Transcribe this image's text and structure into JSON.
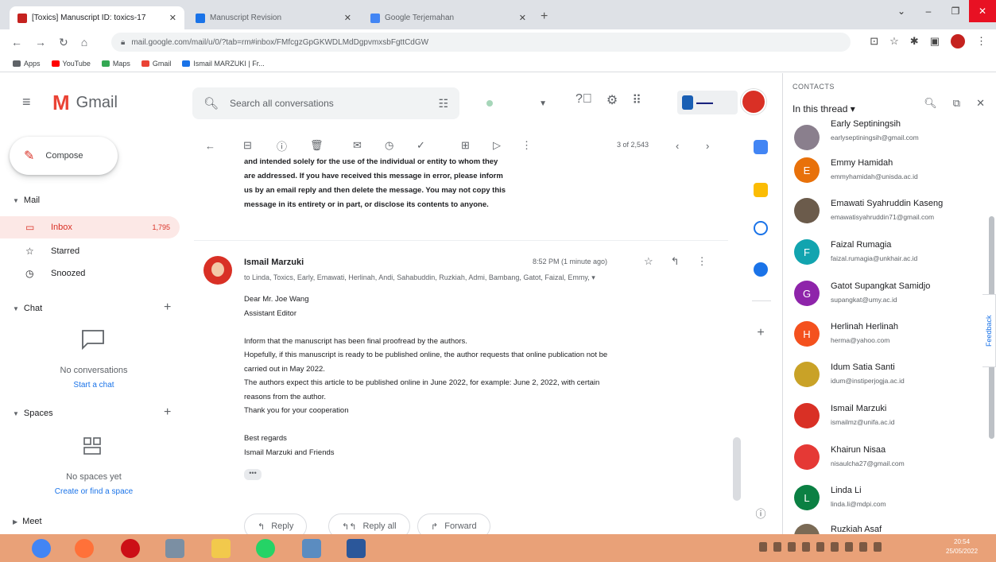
{
  "browser": {
    "tabs": [
      {
        "label": "[Toxics] Manuscript ID: toxics-17",
        "color": "#c5221f"
      },
      {
        "label": "Manuscript Revision",
        "color": "#1a73e8"
      },
      {
        "label": "Google Terjemahan",
        "color": "#4285f4"
      }
    ],
    "url": "mail.google.com/mail/u/0/?tab=rm#inbox/FMfcgzGpGKWDLMdDgpvmxsbFgttCdGW",
    "bookmarks": [
      {
        "label": "Apps",
        "color": "#5f6368"
      },
      {
        "label": "YouTube",
        "color": "#ff0000"
      },
      {
        "label": "Maps",
        "color": "#34a853"
      },
      {
        "label": "Gmail",
        "color": "#ea4335"
      },
      {
        "label": "Ismail MARZUKI | Fr...",
        "color": "#1a73e8"
      }
    ]
  },
  "gmail": {
    "logo_text": "Gmail",
    "search_placeholder": "Search all conversations",
    "compose_label": "Compose",
    "mail_section": "Mail",
    "nav": [
      {
        "label": "Inbox",
        "count": "1,795",
        "icon": "inbox-icon"
      },
      {
        "label": "Starred",
        "count": "",
        "icon": "star-icon"
      },
      {
        "label": "Snoozed",
        "count": "",
        "icon": "clock-icon"
      }
    ],
    "chat_section": "Chat",
    "chat_empty": "No conversations",
    "chat_link": "Start a chat",
    "spaces_section": "Spaces",
    "spaces_empty": "No spaces yet",
    "spaces_link": "Create or find a space",
    "meet_section": "Meet"
  },
  "toolbar": {
    "pager": "3 of 2,543"
  },
  "message_prev": {
    "lines": [
      "and intended solely for the use of the individual or entity to whom they",
      "are addressed. If you have received this message in error, please inform",
      "us by an email reply and then delete the message. You may not copy this",
      "message in its entirety or in part, or disclose its contents to anyone."
    ]
  },
  "message": {
    "sender": "Ismail Marzuki",
    "time": "8:52 PM (1 minute ago)",
    "recipients": "to Linda, Toxics, Early, Emawati, Herlinah, Andi, Sahabuddin, Ruzkiah, Admi, Bambang, Gatot, Faizal, Emmy,",
    "body": [
      "Dear Mr. Joe Wang",
      "Assistant Editor",
      "",
      "Inform that the manuscript has been final proofread by the authors.",
      "Hopefully, if this manuscript is ready to be published online, the author requests that online publication not be",
      "carried out in May 2022.",
      "The authors expect this article to be published online in June 2022, for example: June 2, 2022, with certain",
      "reasons from the author.",
      "Thank you for your cooperation",
      "",
      "Best regards",
      "Ismail Marzuki and Friends"
    ],
    "ellipsis": "•••",
    "reply": "Reply",
    "reply_all": "Reply all",
    "forward": "Forward"
  },
  "contacts": {
    "header": "CONTACTS",
    "subheader": "In this thread",
    "list": [
      {
        "name": "Early Septiningsih",
        "email": "earlyseptiningsih@gmail.com",
        "initial": "",
        "color": "#8a7f8d"
      },
      {
        "name": "Emmy Hamidah",
        "email": "emmyhamidah@unisda.ac.id",
        "initial": "E",
        "color": "#e8710a"
      },
      {
        "name": "Emawati Syahruddin Kaseng",
        "email": "emawatisyahruddin71@gmail.com",
        "initial": "",
        "color": "#6b5b4b"
      },
      {
        "name": "Faizal Rumagia",
        "email": "faizal.rumagia@unkhair.ac.id",
        "initial": "F",
        "color": "#12a4af"
      },
      {
        "name": "Gatot Supangkat Samidjo",
        "email": "supangkat@umy.ac.id",
        "initial": "G",
        "color": "#8e24aa"
      },
      {
        "name": "Herlinah Herlinah",
        "email": "herma@yahoo.com",
        "initial": "H",
        "color": "#f4511e"
      },
      {
        "name": "Idum Satia Santi",
        "email": "idum@instiperjogja.ac.id",
        "initial": "",
        "color": "#c9a227"
      },
      {
        "name": "Ismail Marzuki",
        "email": "ismailmz@unifa.ac.id",
        "initial": "",
        "color": "#d93025"
      },
      {
        "name": "Khairun Nisaa",
        "email": "nisaulcha27@gmail.com",
        "initial": "",
        "color": "#e53935"
      },
      {
        "name": "Linda Li",
        "email": "linda.li@mdpi.com",
        "initial": "L",
        "color": "#0b8043"
      },
      {
        "name": "Ruzkiah Asaf",
        "email": "",
        "initial": "",
        "color": "#7a6a55"
      }
    ],
    "feedback": "Feedback"
  },
  "taskbar": {
    "time": "20:54",
    "date": "25/05/2022"
  }
}
